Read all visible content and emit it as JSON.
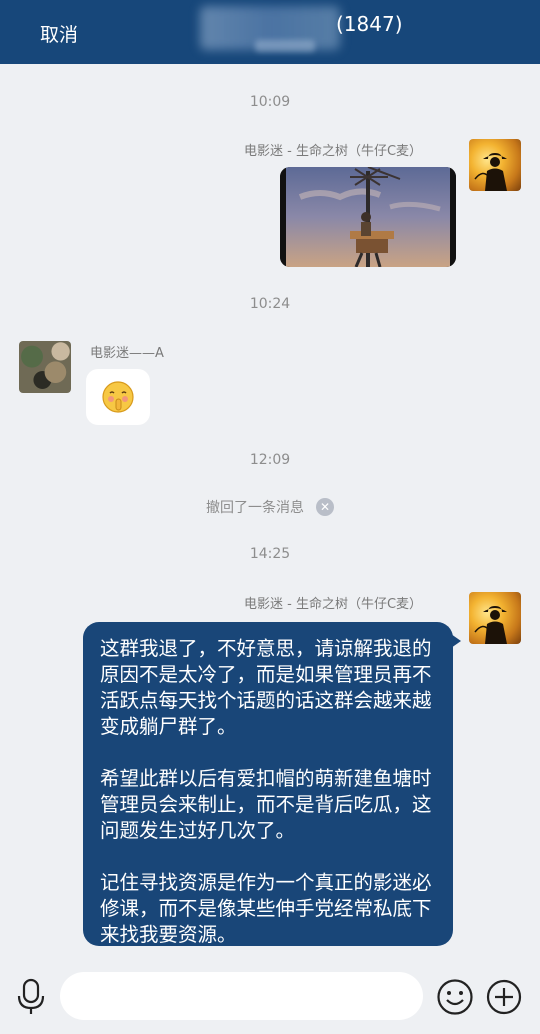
{
  "header": {
    "cancel_label": "取消",
    "title_count": "(1847)"
  },
  "messages": {
    "time_1": "10:09",
    "nick_1": "电影迷 - 生命之树（牛仔C麦）",
    "time_2": "10:24",
    "nick_2": "电影迷——A",
    "time_3": "12:09",
    "recall_text": "撤回了一条消息",
    "time_4": "14:25",
    "nick_3": "电影迷 - 生命之树（牛仔C麦）",
    "long_text": {
      "para_1": "这群我退了，不好意思，请谅解我退的原因不是太冷了，而是如果管理员再不活跃点每天找个话题的话这群会越来越变成躺尸群了。",
      "para_2": "希望此群以后有爱扣帽的萌新建鱼塘时管理员会来制止，而不是背后吃瓜，这问题发生过好几次了。",
      "para_3": "记住寻找资源是作为一个真正的影迷必修课，而不是像某些伸手党经常私底下来找我要资源。"
    }
  },
  "icons": {
    "voice": "microphone-icon",
    "emoji": "smiley-icon",
    "plus": "plus-circle-icon",
    "recall_close": "close-circle-icon"
  },
  "colors": {
    "header_bg": "#17477a",
    "bubble_bg": "#194678",
    "page_bg": "#eef0f3"
  }
}
